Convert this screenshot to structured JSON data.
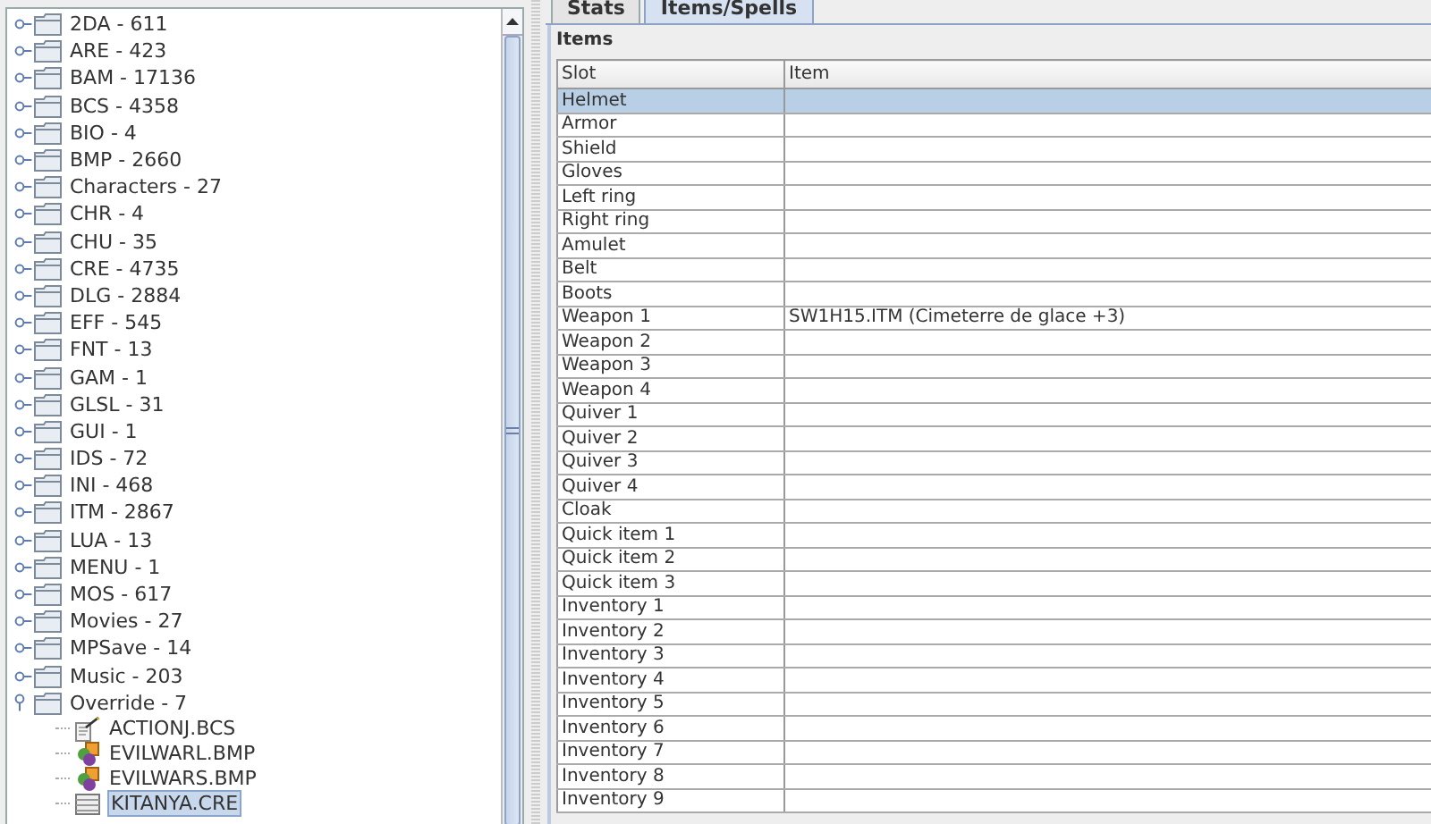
{
  "tree": {
    "items": [
      {
        "label": "2DA - 611",
        "expanded": false,
        "selected": false
      },
      {
        "label": "ARE - 423",
        "expanded": false,
        "selected": false
      },
      {
        "label": "BAM - 17136",
        "expanded": false,
        "selected": false
      },
      {
        "label": "BCS - 4358",
        "expanded": false,
        "selected": false
      },
      {
        "label": "BIO - 4",
        "expanded": false,
        "selected": false
      },
      {
        "label": "BMP - 2660",
        "expanded": false,
        "selected": false
      },
      {
        "label": "Characters - 27",
        "expanded": false,
        "selected": false
      },
      {
        "label": "CHR - 4",
        "expanded": false,
        "selected": false
      },
      {
        "label": "CHU - 35",
        "expanded": false,
        "selected": false
      },
      {
        "label": "CRE - 4735",
        "expanded": false,
        "selected": false
      },
      {
        "label": "DLG - 2884",
        "expanded": false,
        "selected": false
      },
      {
        "label": "EFF - 545",
        "expanded": false,
        "selected": false
      },
      {
        "label": "FNT - 13",
        "expanded": false,
        "selected": false
      },
      {
        "label": "GAM - 1",
        "expanded": false,
        "selected": false
      },
      {
        "label": "GLSL - 31",
        "expanded": false,
        "selected": false
      },
      {
        "label": "GUI - 1",
        "expanded": false,
        "selected": false
      },
      {
        "label": "IDS - 72",
        "expanded": false,
        "selected": false
      },
      {
        "label": "INI - 468",
        "expanded": false,
        "selected": false
      },
      {
        "label": "ITM - 2867",
        "expanded": false,
        "selected": false
      },
      {
        "label": "LUA - 13",
        "expanded": false,
        "selected": false
      },
      {
        "label": "MENU - 1",
        "expanded": false,
        "selected": false
      },
      {
        "label": "MOS - 617",
        "expanded": false,
        "selected": false
      },
      {
        "label": "Movies - 27",
        "expanded": false,
        "selected": false
      },
      {
        "label": "MPSave - 14",
        "expanded": false,
        "selected": false
      },
      {
        "label": "Music - 203",
        "expanded": false,
        "selected": false
      },
      {
        "label": "Override - 7",
        "expanded": true,
        "selected": false,
        "children": [
          {
            "label": "ACTIONJ.BCS",
            "kind": "script",
            "selected": false
          },
          {
            "label": "EVILWARL.BMP",
            "kind": "image",
            "selected": false
          },
          {
            "label": "EVILWARS.BMP",
            "kind": "image",
            "selected": false
          },
          {
            "label": "KITANYA.CRE",
            "kind": "creature",
            "selected": true
          }
        ]
      }
    ]
  },
  "tabs": [
    {
      "label": "Stats",
      "selected": false
    },
    {
      "label": "Items/Spells",
      "selected": true
    }
  ],
  "items_panel": {
    "title": "Items",
    "table": {
      "columns": [
        "Slot",
        "Item"
      ],
      "rows": [
        {
          "slot": "Helmet",
          "selected": true
        },
        {
          "slot": "Armor",
          "selected": false
        },
        {
          "slot": "Shield",
          "selected": false
        },
        {
          "slot": "Gloves",
          "selected": false
        },
        {
          "slot": "Left ring",
          "selected": false
        },
        {
          "slot": "Right ring",
          "selected": false
        },
        {
          "slot": "Amulet",
          "selected": false
        },
        {
          "slot": "Belt",
          "selected": false
        },
        {
          "slot": "Boots",
          "selected": false
        },
        {
          "slot": "Weapon 1",
          "item": "SW1H15.ITM (Cimeterre de glace +3)",
          "selected": false
        },
        {
          "slot": "Weapon 2",
          "selected": false
        },
        {
          "slot": "Weapon 3",
          "selected": false
        },
        {
          "slot": "Weapon 4",
          "selected": false
        },
        {
          "slot": "Quiver 1",
          "selected": false
        },
        {
          "slot": "Quiver 2",
          "selected": false
        },
        {
          "slot": "Quiver 3",
          "selected": false
        },
        {
          "slot": "Quiver 4",
          "selected": false
        },
        {
          "slot": "Cloak",
          "selected": false
        },
        {
          "slot": "Quick item 1",
          "selected": false
        },
        {
          "slot": "Quick item 2",
          "selected": false
        },
        {
          "slot": "Quick item 3",
          "selected": false
        },
        {
          "slot": "Inventory 1",
          "selected": false
        },
        {
          "slot": "Inventory 2",
          "selected": false
        },
        {
          "slot": "Inventory 3",
          "selected": false
        },
        {
          "slot": "Inventory 4",
          "selected": false
        },
        {
          "slot": "Inventory 5",
          "selected": false
        },
        {
          "slot": "Inventory 6",
          "selected": false
        },
        {
          "slot": "Inventory 7",
          "selected": false
        },
        {
          "slot": "Inventory 8",
          "selected": false
        },
        {
          "slot": "Inventory 9",
          "selected": false
        }
      ]
    }
  }
}
